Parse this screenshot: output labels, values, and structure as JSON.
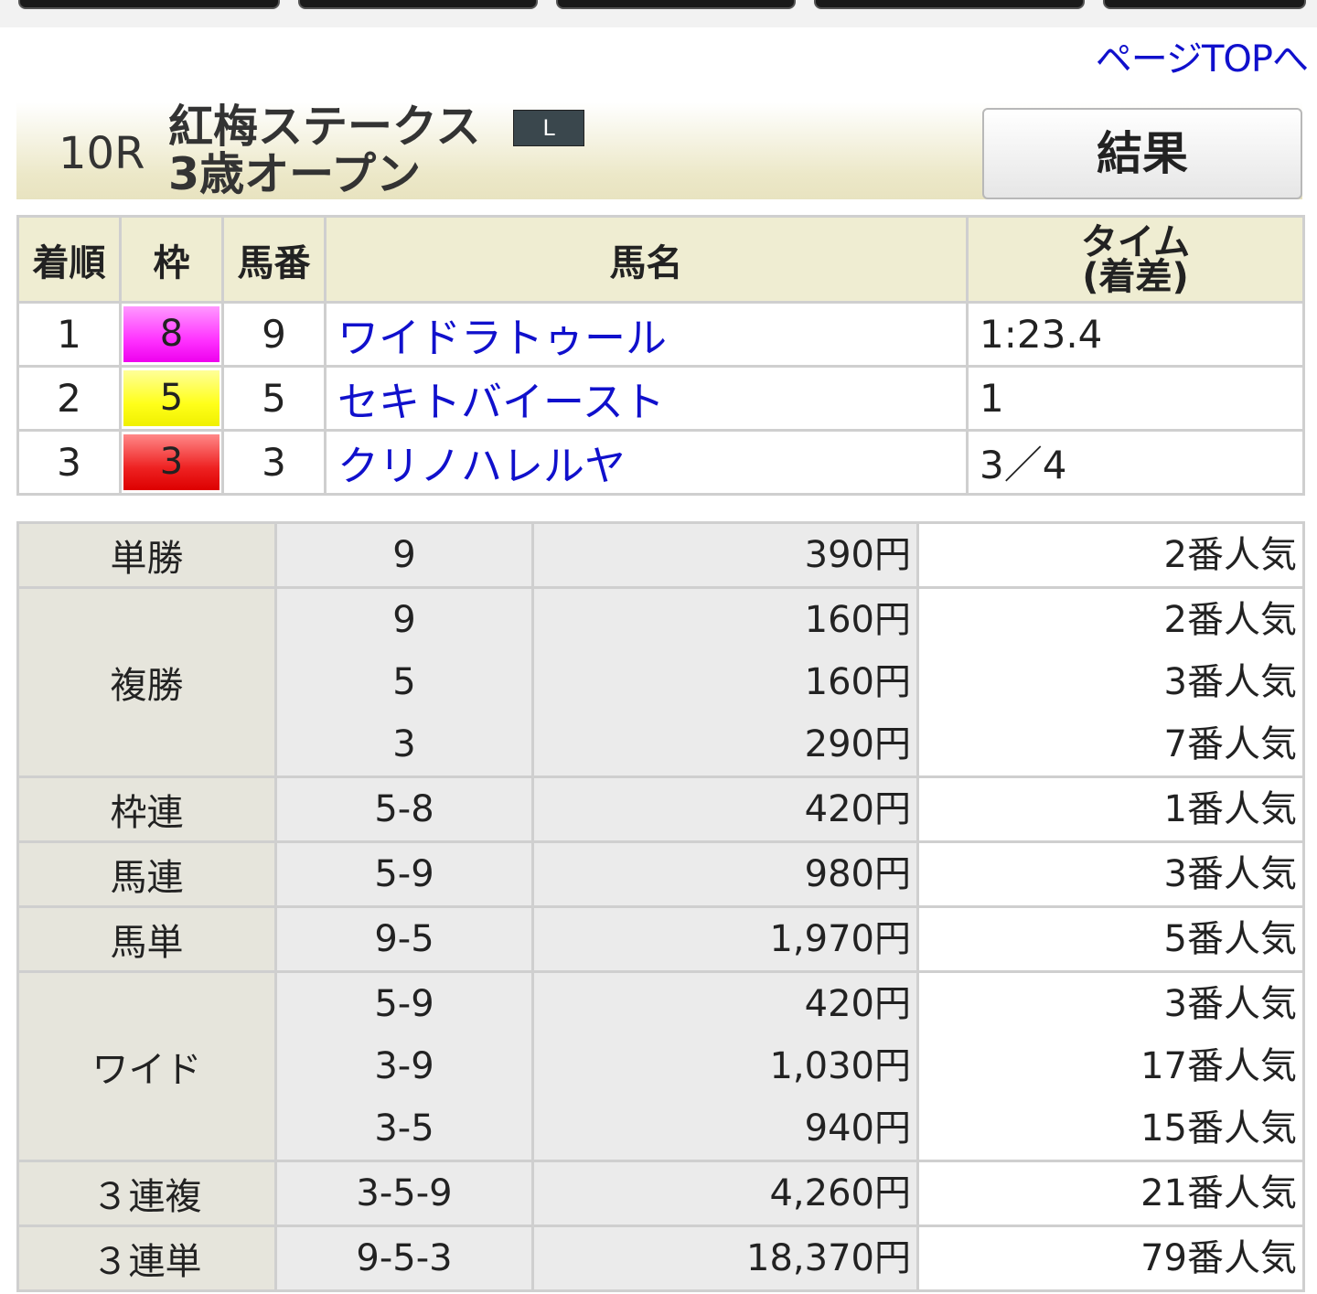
{
  "nav": {
    "page_top": "ページTOPへ"
  },
  "race": {
    "number": "10R",
    "name": "紅梅ステークス",
    "class": "3歳オープン",
    "grade": "L",
    "result_button": "結果"
  },
  "results": {
    "headers": {
      "rank": "着順",
      "waku": "枠",
      "umaban": "馬番",
      "horse": "馬名",
      "time_line1": "タイム",
      "time_line2": "(着差)"
    },
    "rows": [
      {
        "rank": "1",
        "waku": "8",
        "waku_color": "#ff33ff",
        "umaban": "9",
        "horse": "ワイドラトゥール",
        "time": "1:23.4"
      },
      {
        "rank": "2",
        "waku": "5",
        "waku_color": "#ffff1a",
        "umaban": "5",
        "horse": "セキトバイースト",
        "time": "1"
      },
      {
        "rank": "3",
        "waku": "3",
        "waku_color": "#ee2222",
        "umaban": "3",
        "horse": "クリノハレルヤ",
        "time": "3／4"
      }
    ]
  },
  "payouts": [
    {
      "type": "単勝",
      "entries": [
        {
          "num": "9",
          "amount": "390円",
          "pop": "2番人気"
        }
      ]
    },
    {
      "type": "複勝",
      "entries": [
        {
          "num": "9",
          "amount": "160円",
          "pop": "2番人気"
        },
        {
          "num": "5",
          "amount": "160円",
          "pop": "3番人気"
        },
        {
          "num": "3",
          "amount": "290円",
          "pop": "7番人気"
        }
      ]
    },
    {
      "type": "枠連",
      "entries": [
        {
          "num": "5-8",
          "amount": "420円",
          "pop": "1番人気"
        }
      ]
    },
    {
      "type": "馬連",
      "entries": [
        {
          "num": "5-9",
          "amount": "980円",
          "pop": "3番人気"
        }
      ]
    },
    {
      "type": "馬単",
      "entries": [
        {
          "num": "9-5",
          "amount": "1,970円",
          "pop": "5番人気"
        }
      ]
    },
    {
      "type": "ワイド",
      "entries": [
        {
          "num": "5-9",
          "amount": "420円",
          "pop": "3番人気"
        },
        {
          "num": "3-9",
          "amount": "1,030円",
          "pop": "17番人気"
        },
        {
          "num": "3-5",
          "amount": "940円",
          "pop": "15番人気"
        }
      ]
    },
    {
      "type": "３連複",
      "entries": [
        {
          "num": "3-5-9",
          "amount": "4,260円",
          "pop": "21番人気"
        }
      ]
    },
    {
      "type": "３連単",
      "entries": [
        {
          "num": "9-5-3",
          "amount": "18,370円",
          "pop": "79番人気"
        }
      ]
    }
  ]
}
